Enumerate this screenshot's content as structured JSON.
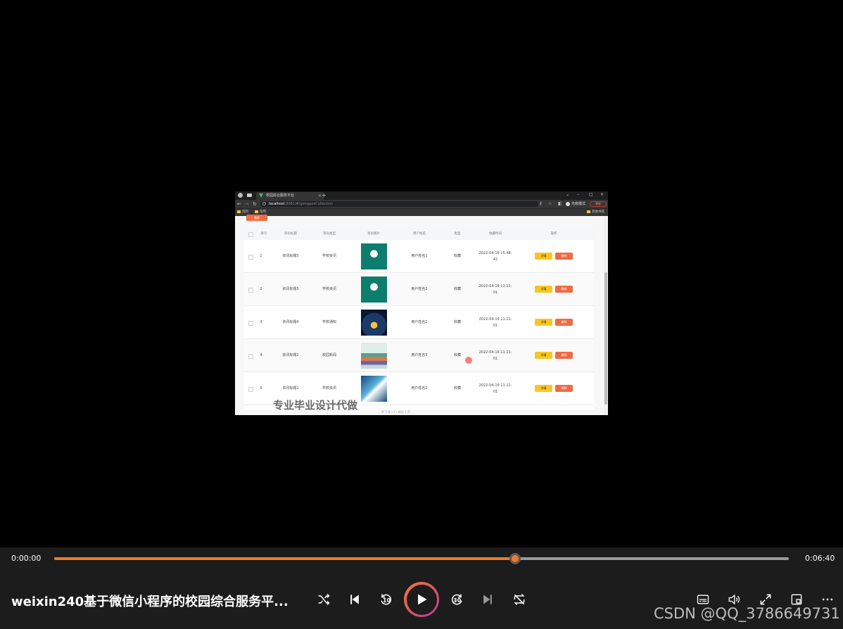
{
  "browser": {
    "tab_title": "校园综合服务平台",
    "url_host": "localhost",
    "url_path": ":8081/#/gonggaoCollection",
    "profile_label": "无痕模式",
    "update_label": "更新",
    "bookmarks": [
      "资料",
      "常用"
    ],
    "other_bookmarks": "其他书签"
  },
  "page": {
    "delete_button": "删除",
    "columns": [
      "索引",
      "资讯标题",
      "资讯类型",
      "资讯图片",
      "用户姓名",
      "类型",
      "收藏时间",
      "操作"
    ],
    "rows": [
      {
        "index": "1",
        "title": "资讯标题5",
        "type": "学校资讯",
        "user": "用户姓名1",
        "kind": "收藏",
        "time1": "2022-04-19 15:48:",
        "time2": "42"
      },
      {
        "index": "2",
        "title": "资讯标题5",
        "type": "学校资讯",
        "user": "用户姓名2",
        "kind": "收藏",
        "time1": "2022-04-19 11:11:",
        "time2": "01"
      },
      {
        "index": "3",
        "title": "资讯标题4",
        "type": "学校通知",
        "user": "用户姓名2",
        "kind": "收藏",
        "time1": "2022-04-19 11:11:",
        "time2": "01"
      },
      {
        "index": "4",
        "title": "资讯标题2",
        "type": "校园新闻",
        "user": "用户姓名3",
        "kind": "收藏",
        "time1": "2022-04-19 11:11:",
        "time2": "01"
      },
      {
        "index": "5",
        "title": "资讯标题1",
        "type": "学校资讯",
        "user": "用户姓名2",
        "kind": "收藏",
        "time1": "2022-04-19 11:11:",
        "time2": "01"
      }
    ],
    "detail_label": "详情",
    "row_delete_label": "删除",
    "pager": "共 5 条    ‹   1   ›    前往   1   页",
    "watermark": "专业毕业设计代做"
  },
  "player": {
    "current_time": "0:00:00",
    "total_time": "0:06:40",
    "progress": 0.627,
    "title": "weixin240基于微信小程序的校园综合服务平...",
    "skip_back_label": "10",
    "skip_forward_label": "30",
    "attribution": "CSDN @QQ_3786649731",
    "colors": {
      "accent": "#f07a2c",
      "gradient_end": "#c2379b"
    }
  }
}
